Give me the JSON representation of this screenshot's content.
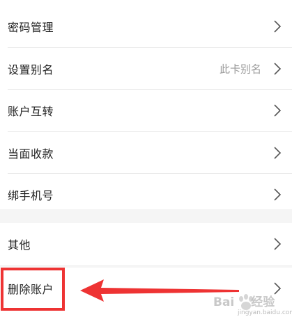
{
  "settings": {
    "items": [
      {
        "label": "密码管理",
        "value": ""
      },
      {
        "label": "设置别名",
        "value": "此卡别名"
      },
      {
        "label": "账户互转",
        "value": ""
      },
      {
        "label": "当面收款",
        "value": ""
      },
      {
        "label": "绑手机号",
        "value": ""
      }
    ],
    "other_items": [
      {
        "label": "其他",
        "value": ""
      },
      {
        "label": "删除账户",
        "value": ""
      }
    ]
  },
  "annotation": {
    "highlight_color": "#ee3333",
    "arrow_color": "#ee3333"
  },
  "watermark": {
    "brand": "Bai",
    "brand_suffix": "经验",
    "url": "jingyan.baidu.com"
  }
}
